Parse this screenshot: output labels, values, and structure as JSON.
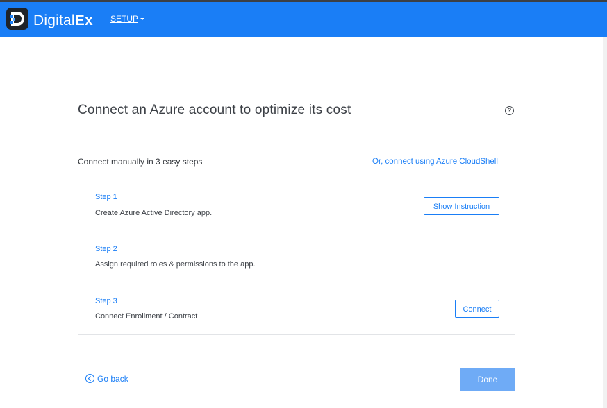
{
  "brand": {
    "name_regular": "Digital",
    "name_bold": "Ex",
    "colors": {
      "navbar": "#1a7ef6",
      "logo_bg": "#1f2329",
      "accent": "#1a7ef6"
    }
  },
  "nav": {
    "setup_label": "SETUP"
  },
  "page": {
    "title": "Connect an Azure account to optimize its cost",
    "help_icon": "?",
    "subtitle": "Connect manually in 3 easy steps",
    "cloudshell_link": "Or, connect using Azure CloudShell"
  },
  "steps": [
    {
      "label": "Step 1",
      "description": "Create Azure Active Directory app.",
      "action": "Show Instruction"
    },
    {
      "label": "Step 2",
      "description": "Assign required roles & permissions to the app."
    },
    {
      "label": "Step 3",
      "description": "Connect Enrollment / Contract",
      "action": "Connect"
    }
  ],
  "footer": {
    "back_label": "Go back",
    "done_label": "Done"
  },
  "icons": [
    "digitalex-logo-icon",
    "chevron-down-icon",
    "help-circle-icon",
    "back-circle-icon"
  ]
}
